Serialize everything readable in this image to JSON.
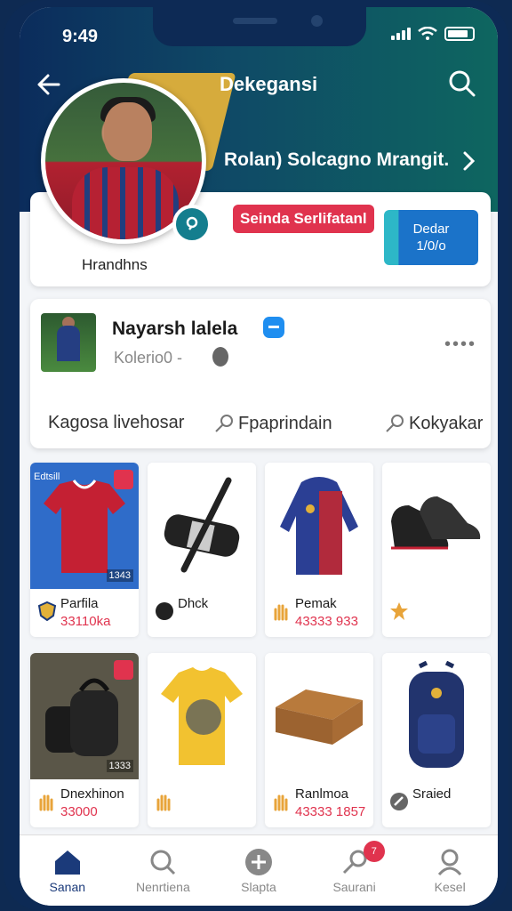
{
  "status": {
    "time": "9:49"
  },
  "header": {
    "title": "Dekegansi",
    "subtitle": "Rolan) Solcagno Mrangit."
  },
  "profile": {
    "handle": "Hrandhns",
    "pill_label": "Seinda Serlifatanl",
    "button_label_line1": "Dedar",
    "button_label_line2": "1/0/o"
  },
  "post": {
    "name": "Nayarsh lalela",
    "sub": "Kolerio0 -",
    "more": "••••",
    "actions": [
      "Kagosa livehosar",
      "Fpaprindain",
      "Kokyakar"
    ]
  },
  "products": [
    {
      "name": "Parfila",
      "price": "33110ka",
      "icon": "shield-icon",
      "image": "red-jersey",
      "corner": "Edtsill",
      "chip": "1343"
    },
    {
      "name": "Dhck",
      "price": "",
      "icon": "ball-icon",
      "image": "black-roll-bag"
    },
    {
      "name": "Pemak",
      "price": "43333 933",
      "icon": "hand-icon",
      "image": "blue-jacket"
    },
    {
      "name": "",
      "price": "",
      "icon": "star-icon",
      "image": "black-shoes"
    },
    {
      "name": "Dnexhinon",
      "price": "33000",
      "icon": "hand-icon",
      "image": "black-bag",
      "chip": "1333"
    },
    {
      "name": "",
      "price": "",
      "icon": "hand-icon",
      "image": "yellow-shirt"
    },
    {
      "name": "Ranlmoa",
      "price": "43333 1857",
      "icon": "hand-icon",
      "image": "wicker-case"
    },
    {
      "name": "Sraied",
      "price": "",
      "icon": "rotate-icon",
      "image": "navy-backpack"
    }
  ],
  "tabs": [
    {
      "label": "Sanan",
      "icon": "home-icon",
      "active": true
    },
    {
      "label": "Nenrtiena",
      "icon": "search-icon"
    },
    {
      "label": "Slapta",
      "icon": "plus-icon"
    },
    {
      "label": "Saurani",
      "icon": "bell-icon",
      "badge": "7"
    },
    {
      "label": "Kesel",
      "icon": "profile-icon"
    }
  ],
  "colors": {
    "accent": "#e0334e",
    "brand": "#0d2a55",
    "teal": "#0e6660",
    "blue": "#1b73c9"
  }
}
